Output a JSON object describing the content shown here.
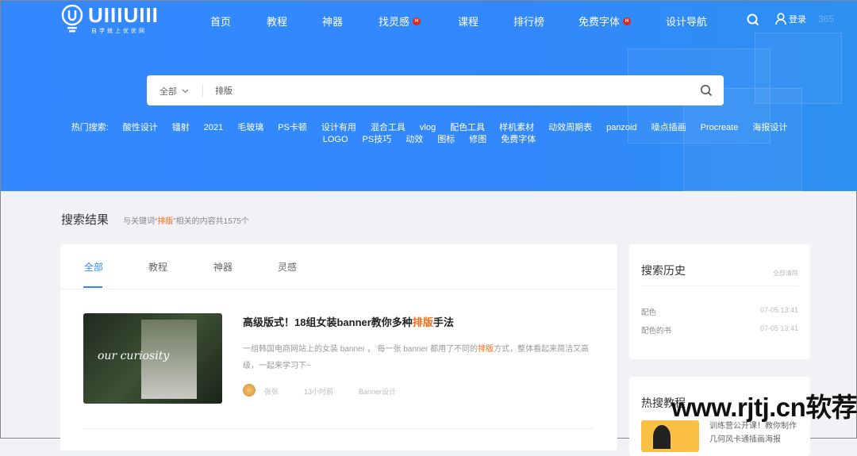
{
  "nav": {
    "logo_text": "UIIIUIII",
    "logo_tagline": "自学就上优优网",
    "items": [
      {
        "label": "首页"
      },
      {
        "label": "教程"
      },
      {
        "label": "神器"
      },
      {
        "label": "找灵感",
        "badge": "H"
      },
      {
        "label": "课程"
      },
      {
        "label": "排行榜"
      },
      {
        "label": "免费字体",
        "badge": "H"
      },
      {
        "label": "设计导航"
      }
    ],
    "login": "登录",
    "extra": "365"
  },
  "search": {
    "category": "全部",
    "value": "排版"
  },
  "hot_search": {
    "label": "热门搜索:",
    "terms": [
      "酸性设计",
      "镭射",
      "2021",
      "毛玻璃",
      "PS卡顿",
      "设计有用",
      "混合工具",
      "vlog",
      "配色工具",
      "样机素材",
      "动效周期表",
      "panzoid",
      "噪点插画",
      "Procreate",
      "海报设计",
      "LOGO",
      "PS技巧",
      "动效",
      "图标",
      "修图",
      "免费字体"
    ]
  },
  "results": {
    "title": "搜索结果",
    "prefix": "与关键词“",
    "keyword": "排版",
    "suffix": "”相关的内容共1575个"
  },
  "tabs": [
    "全部",
    "教程",
    "神器",
    "灵感"
  ],
  "article": {
    "title_pre": "高级版式！18组女装banner教你多种",
    "title_kw": "排版",
    "title_post": "手法",
    "desc_pre": "一组韩国电商网站上的女装 banner ， 每一张 banner 都用了不同的",
    "desc_kw": "排版",
    "desc_post": "方式，整体看起来简洁又高级，一起来学习下~",
    "author": "张张",
    "time": "13小时前",
    "category": "Banner设计",
    "thumb_text": "our curiosity"
  },
  "history": {
    "title": "搜索历史",
    "clear": "全部清除",
    "items": [
      {
        "term": "配色",
        "time": "07-05 13:41"
      },
      {
        "term": "配色的书",
        "time": "07-05 13:41"
      }
    ]
  },
  "hot_tutorials": {
    "title": "热搜教程",
    "items": [
      {
        "title": "训练营公开课！教你制作几何风卡通插画海报"
      }
    ]
  },
  "watermark": "www.rjtj.cn软荐网",
  "colors": {
    "brand": "#3388ff",
    "keyword": "#ff6a13",
    "badge": "#e1251b"
  }
}
